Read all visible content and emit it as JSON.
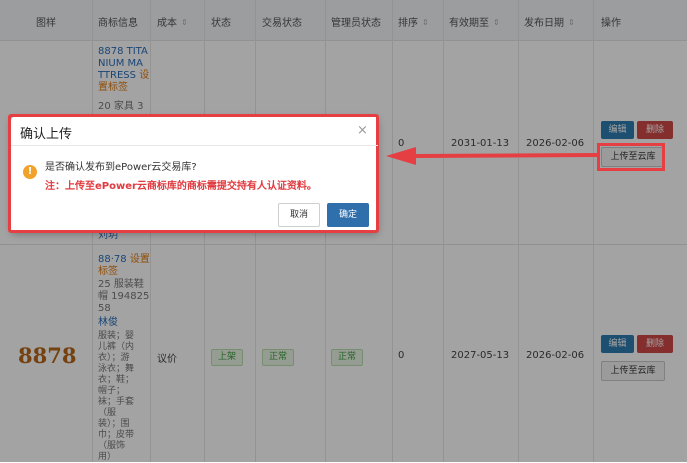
{
  "table": {
    "headers": {
      "sample": "图样",
      "info": "商标信息",
      "cost": "成本",
      "status": "状态",
      "trade_status": "交易状态",
      "admin_status": "管理员状态",
      "sort": "排序",
      "expiry": "有效期至",
      "publish": "发布日期",
      "ops": "操作"
    },
    "sort_glyph": "⇕",
    "row1": {
      "name_lines": [
        "8878 TITA",
        "NIUM MA",
        "TTRESS"
      ],
      "set_label_a": "设",
      "set_label_b": "置标签",
      "class_line": "20 家具 3",
      "tail": "刘玥",
      "sort": "0",
      "expiry": "2031-01-13",
      "publish": "2026-02-06",
      "edit": "编辑",
      "delete": "删除",
      "upload": "上传至云库"
    },
    "row2": {
      "mark_text": "8878",
      "name_a": "88·78",
      "set_label_a": "设置",
      "set_label_b": "标签",
      "class_lines": [
        "25 服装鞋",
        "帽 194825",
        "58"
      ],
      "owner": "林俊",
      "goods_lines": [
        "服装；婴",
        "儿裤（内",
        "衣）；游",
        "泳衣；舞",
        "衣；鞋；",
        "帽子；",
        "袜；手套",
        "（服",
        "装）；围",
        "巾；皮带",
        "（服饰",
        "用）"
      ],
      "cost": "议价",
      "status": "上架",
      "trade_status": "正常",
      "admin_status": "正常",
      "sort": "0",
      "expiry": "2027-05-13",
      "publish": "2026-02-06",
      "edit": "编辑",
      "delete": "删除",
      "upload": "上传至云库"
    }
  },
  "dialog": {
    "title": "确认上传",
    "close": "×",
    "warn_glyph": "!",
    "message": "是否确认发布到ePower云交易库?",
    "note": "注：上传至ePower云商标库的商标需提交持有人认证资料。",
    "cancel": "取消",
    "ok": "确定"
  },
  "colors": {
    "annotation_red": "#e53f43",
    "primary": "#2e7cb0",
    "danger": "#cf4a48",
    "warning": "#f0a22b"
  }
}
